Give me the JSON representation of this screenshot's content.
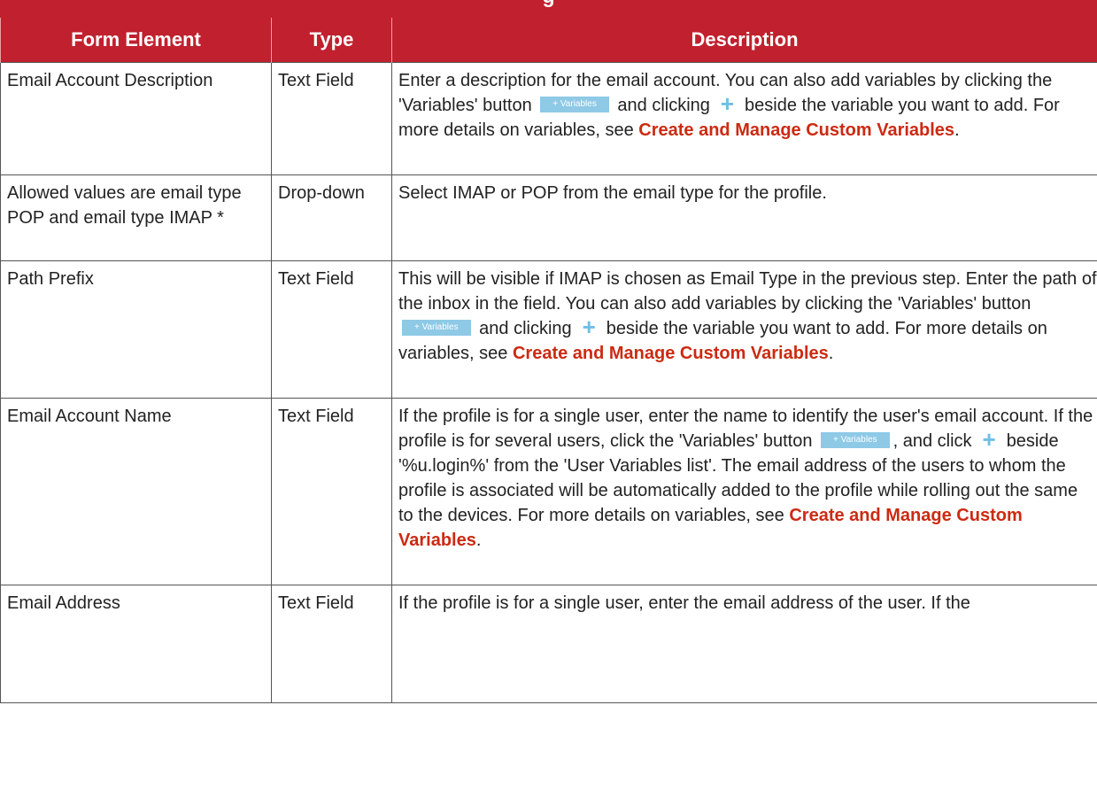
{
  "table": {
    "headers": {
      "element": "Form Element",
      "type": "Type",
      "description": "Description"
    },
    "variables_button_label": "+ Variables",
    "plus_icon": "+",
    "rows": [
      {
        "element": "Email Account Description",
        "type": "Text Field",
        "desc_a": "Enter a description for the email account. You can also add variables by clicking the 'Variables' button",
        "desc_b": "and clicking",
        "desc_c": "beside the variable you want to add. For more details on variables, see",
        "link": "Create and Manage Custom Variables",
        "desc_d": "."
      },
      {
        "element": "Allowed values are email type POP and email type IMAP *",
        "type": "Drop-down",
        "desc_a": "Select IMAP or POP from the email type for the profile."
      },
      {
        "element": "Path Prefix",
        "type": "Text Field",
        "desc_a": "This will be visible if IMAP is chosen as Email Type in the previous step. Enter the path of the inbox in the field. You can also add variables by clicking the 'Variables' button",
        "desc_b": "and clicking",
        "desc_c": "beside the variable you want to add. For more details on variables, see",
        "link": "Create and Manage Custom Variables",
        "desc_d": "."
      },
      {
        "element": "Email Account Name",
        "type": "Text Field",
        "desc_a": "If the profile is for a single user, enter the name to identify the user's email account. If the profile is for several users, click the 'Variables' button",
        "desc_b": ", and click",
        "desc_c": "beside '%u.login%' from the 'User Variables list'. The email address of the users to whom the profile is associated will be automatically added to the profile while rolling out the same to the devices. For more details on variables, see",
        "link": "Create and Manage Custom Variables",
        "desc_d": "."
      },
      {
        "element": "Email Address",
        "type": "Text Field",
        "desc_a": "If the profile is for a single user, enter the email address of the user. If the"
      }
    ]
  },
  "colors": {
    "header_bg": "#c1202e",
    "link": "#cc2a12",
    "variables_button": "#8ec9e6",
    "plus_icon": "#6fbfe6"
  }
}
